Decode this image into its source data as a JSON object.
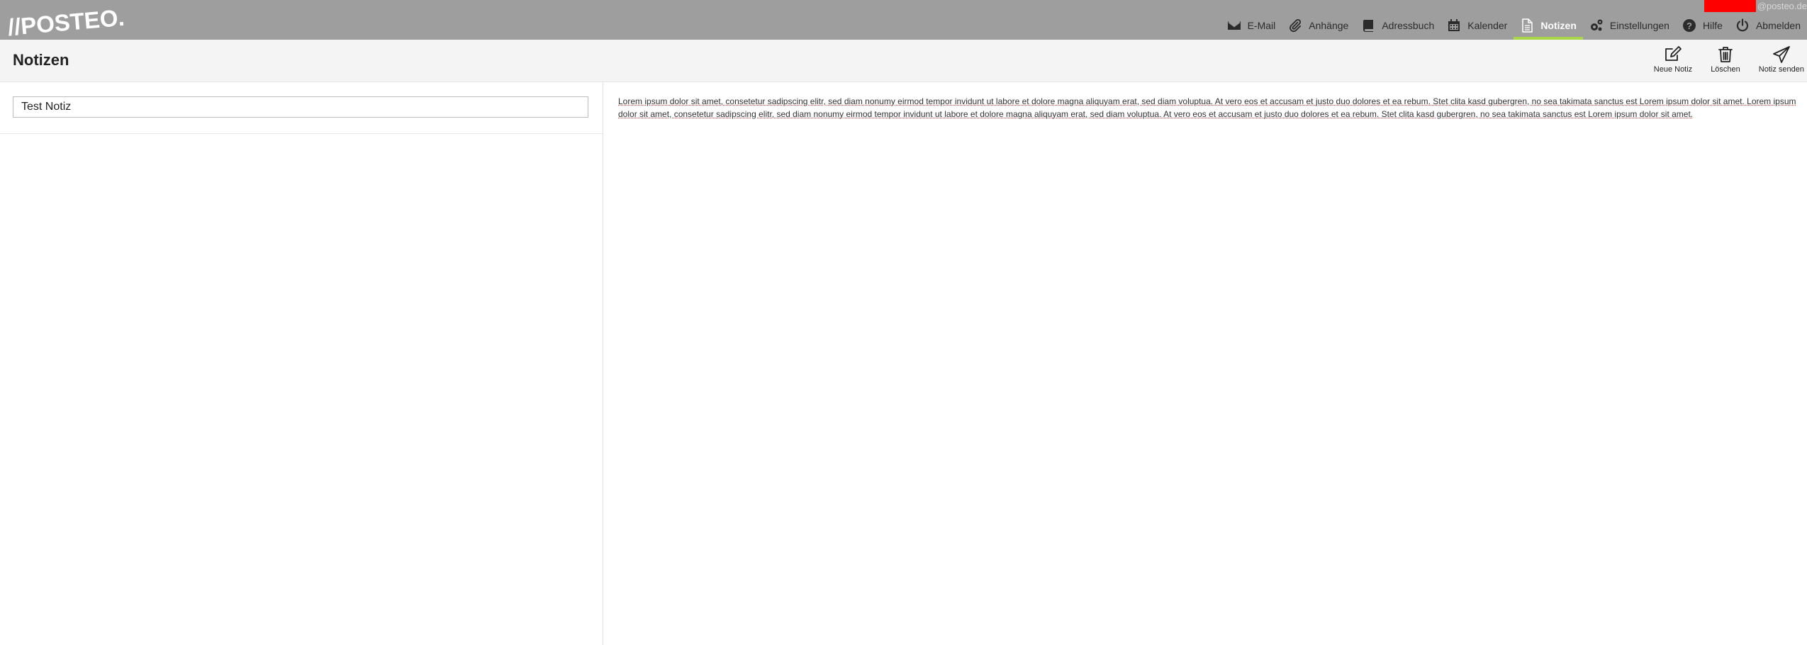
{
  "brand": {
    "logo_text": "//POSTEO."
  },
  "account": {
    "domain": "@posteo.de"
  },
  "nav": {
    "items": [
      {
        "label": "E-Mail",
        "icon": "envelope-icon"
      },
      {
        "label": "Anhänge",
        "icon": "paperclip-icon"
      },
      {
        "label": "Adressbuch",
        "icon": "book-icon"
      },
      {
        "label": "Kalender",
        "icon": "calendar-icon"
      },
      {
        "label": "Notizen",
        "icon": "note-icon",
        "active": true
      },
      {
        "label": "Einstellungen",
        "icon": "gears-icon"
      },
      {
        "label": "Hilfe",
        "icon": "help-icon"
      },
      {
        "label": "Abmelden",
        "icon": "power-icon"
      }
    ]
  },
  "page": {
    "title": "Notizen"
  },
  "toolbar": {
    "new_note": "Neue Notiz",
    "delete": "Löschen",
    "send_note": "Notiz senden"
  },
  "note": {
    "title": "Test Notiz",
    "body": "Lorem ipsum dolor sit amet, consetetur sadipscing elitr, sed diam nonumy eirmod tempor invidunt ut labore et dolore magna aliquyam erat, sed diam voluptua. At vero eos et accusam et justo duo dolores et ea rebum. Stet clita kasd gubergren, no sea takimata sanctus est Lorem ipsum dolor sit amet. Lorem ipsum dolor sit amet, consetetur sadipscing elitr, sed diam nonumy eirmod tempor invidunt ut labore et dolore magna aliquyam erat, sed diam voluptua. At vero eos et accusam et justo duo dolores et ea rebum. Stet clita kasd gubergren, no sea takimata sanctus est Lorem ipsum dolor sit amet."
  },
  "colors": {
    "topbar": "#9e9e9e",
    "active_underline": "#a8d648",
    "header_bg": "#f4f4f4",
    "redaction": "#ff0000"
  }
}
